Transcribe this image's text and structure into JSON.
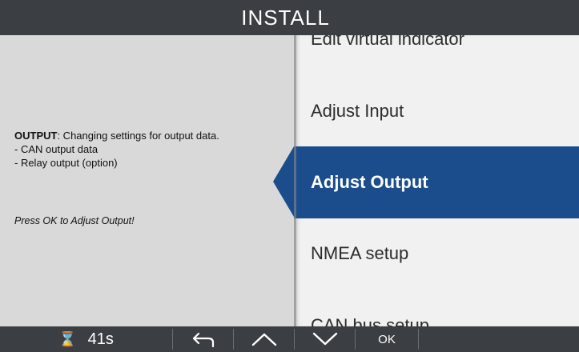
{
  "header": {
    "title": "INSTALL"
  },
  "info": {
    "heading": "OUTPUT",
    "description": ": Changing settings for output data.",
    "bullets": [
      "- CAN output data",
      "- Relay output (option)"
    ],
    "hint": "Press OK to Adjust Output!"
  },
  "menu": {
    "items": [
      {
        "label": "Edit virtual indicator"
      },
      {
        "label": "Adjust Input"
      },
      {
        "label": "Adjust Output",
        "selected": true
      },
      {
        "label": "NMEA setup"
      },
      {
        "label": "CAN bus setup"
      }
    ],
    "selected_color": "#1b4d8c"
  },
  "footer": {
    "timer_icon": "hourglass-icon",
    "timer_value": "41s",
    "back_icon": "back-arrow-icon",
    "up_icon": "chevron-up-icon",
    "down_icon": "chevron-down-icon",
    "ok_label": "OK"
  }
}
